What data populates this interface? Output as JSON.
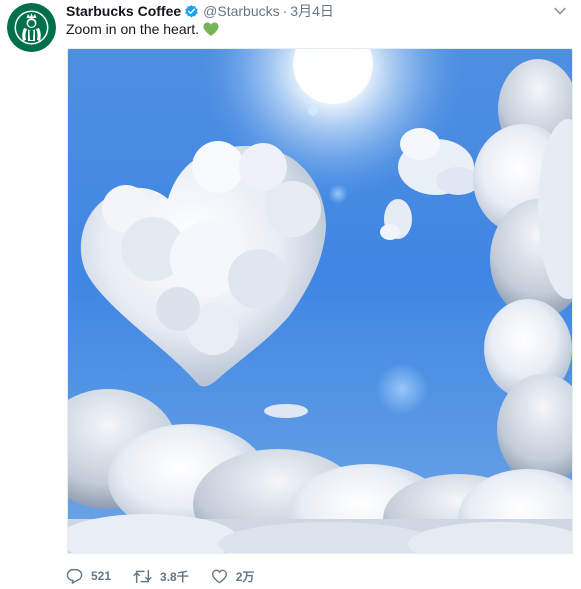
{
  "tweet": {
    "author_name": "Starbucks Coffee",
    "handle": "@Starbucks",
    "separator": "·",
    "date": "3月4日",
    "text": "Zoom in on the heart.",
    "emoji": "green-heart",
    "verified": true
  },
  "actions": {
    "reply_count": "521",
    "retweet_count": "3.8千",
    "like_count": "2万"
  },
  "colors": {
    "brand_green": "#00704a",
    "verified_blue": "#1da1f2",
    "muted": "#657786",
    "emoji_green": "#77b255"
  },
  "icons": [
    "starbucks-logo",
    "verified-badge-icon",
    "chevron-down-icon",
    "reply-icon",
    "retweet-icon",
    "like-icon"
  ]
}
